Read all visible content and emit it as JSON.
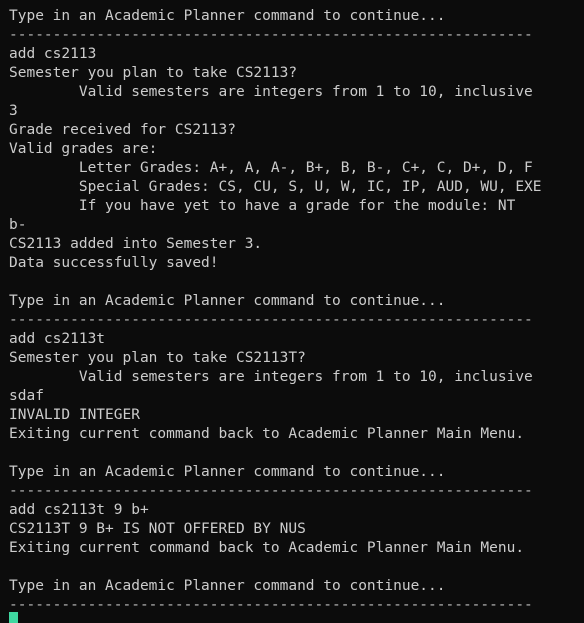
{
  "terminal": {
    "lines": [
      "Type in an Academic Planner command to continue...",
      "------------------------------------------------------------",
      "add cs2113",
      "Semester you plan to take CS2113?",
      "        Valid semesters are integers from 1 to 10, inclusive",
      "3",
      "Grade received for CS2113?",
      "Valid grades are:",
      "        Letter Grades: A+, A, A-, B+, B, B-, C+, C, D+, D, F",
      "        Special Grades: CS, CU, S, U, W, IC, IP, AUD, WU, EXE",
      "        If you have yet to have a grade for the module: NT",
      "b-",
      "CS2113 added into Semester 3.",
      "Data successfully saved!",
      "",
      "Type in an Academic Planner command to continue...",
      "------------------------------------------------------------",
      "add cs2113t",
      "Semester you plan to take CS2113T?",
      "        Valid semesters are integers from 1 to 10, inclusive",
      "sdaf",
      "INVALID INTEGER",
      "Exiting current command back to Academic Planner Main Menu.",
      "",
      "Type in an Academic Planner command to continue...",
      "------------------------------------------------------------",
      "add cs2113t 9 b+",
      "CS2113T 9 B+ IS NOT OFFERED BY NUS",
      "Exiting current command back to Academic Planner Main Menu.",
      "",
      "Type in an Academic Planner command to continue...",
      "------------------------------------------------------------"
    ],
    "colors": {
      "background": "#0c0c0c",
      "text": "#cccccc",
      "cursor": "#3fd7a0"
    }
  }
}
